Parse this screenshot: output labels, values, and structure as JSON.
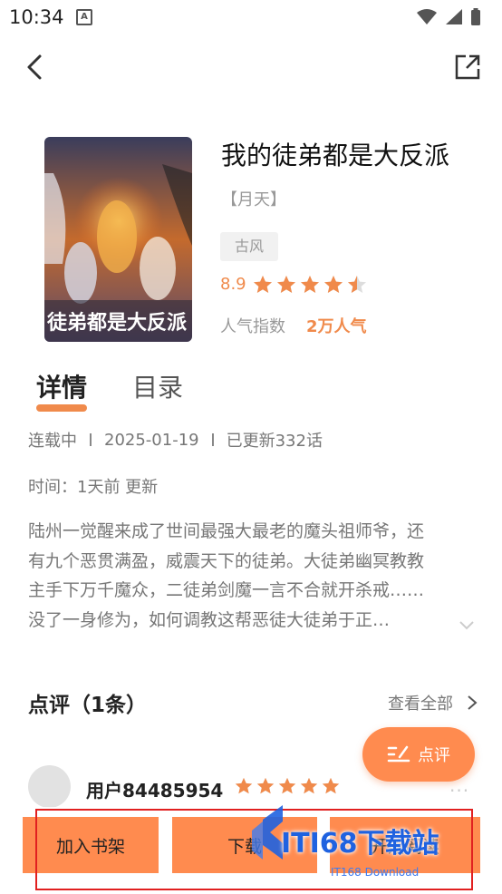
{
  "status_bar": {
    "time": "10:34",
    "notification_icon": "A"
  },
  "book": {
    "title": "我的徒弟都是大反派",
    "author": "【月天】",
    "genre": "古风",
    "rating": "8.9",
    "rating_stars": 4.5,
    "popularity_label": "人气指数",
    "popularity_value": "2万人气",
    "cover_text": "徒弟都是大反派"
  },
  "tabs": {
    "details": "详情",
    "catalog": "目录"
  },
  "meta": {
    "status": "连载中",
    "date": "2025-01-19",
    "chapters": "已更新332话"
  },
  "update_info": "时间：1天前 更新",
  "synopsis_lines": [
    "陆州一觉醒来成了世间最强大最老的魔头祖师爷，还",
    "有九个恶贯满盈，威震天下的徒弟。大徒弟幽冥教教",
    "主手下万千魔众，二徒弟剑魔一言不合就开杀戒……",
    "没了一身修为，如何调教这帮恶徒大徒弟于正…"
  ],
  "reviews": {
    "title": "点评（1条）",
    "view_all": "查看全部",
    "fab_label": "点评",
    "items": [
      {
        "user": "用户84485954",
        "stars": 5,
        "more": "···"
      }
    ]
  },
  "bottom_bar": {
    "shelf": "加入书架",
    "download": "下载",
    "read": "开始阅读"
  },
  "watermark": {
    "text": "ITI68下载站",
    "sub": "IT168 Download"
  },
  "colors": {
    "accent": "#f08a4b",
    "button": "#ff8b4f",
    "highlight": "#e12020",
    "watermark": "#1f62e0"
  }
}
